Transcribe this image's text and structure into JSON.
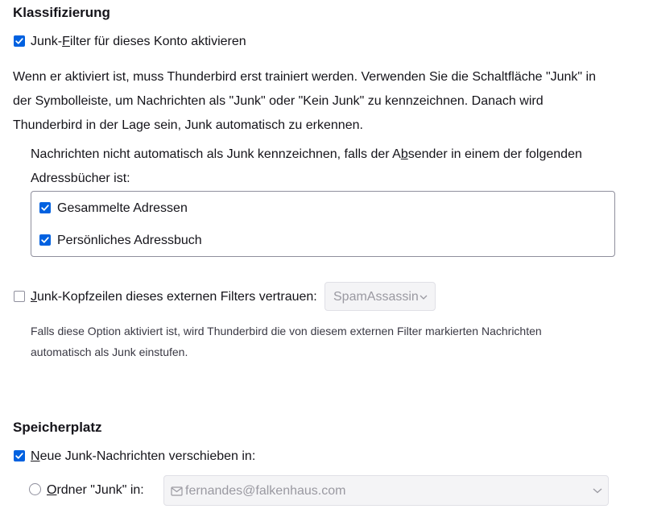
{
  "classification": {
    "heading": "Klassifizierung",
    "enable_junk": {
      "checked": true,
      "label_pre": "Junk-",
      "label_key": "F",
      "label_post": "ilter für dieses Konto aktivieren"
    },
    "description_lines": [
      "Wenn er aktiviert ist, muss Thunderbird erst trainiert werden. Verwenden Sie die Schaltfläche \"Junk\" in",
      "der Symbolleiste, um Nachrichten als \"Junk\" oder \"Kein Junk\" zu kennzeichnen. Danach wird",
      "Thunderbird in der Lage sein, Junk automatisch zu erkennen."
    ],
    "whitelist_intro": {
      "line1_pre": "Nachrichten nicht automatisch als Junk kennzeichnen, falls der A",
      "line1_key": "b",
      "line1_post": "sender in einem der folgenden",
      "line2": "Adressbücher ist:"
    },
    "address_books": [
      {
        "label": "Gesammelte Adressen",
        "checked": true
      },
      {
        "label": "Persönliches Adressbuch",
        "checked": true
      }
    ],
    "trust_headers": {
      "checked": false,
      "label_key": "J",
      "label_post": "unk-Kopfzeilen dieses externen Filters vertrauen:",
      "dropdown_value": "SpamAssassin"
    },
    "trust_note_lines": [
      "Falls diese Option aktiviert ist, wird Thunderbird die von diesem externen Filter markierten Nachrichten",
      "automatisch als Junk einstufen."
    ]
  },
  "storage": {
    "heading": "Speicherplatz",
    "move_junk": {
      "checked": true,
      "label_key": "N",
      "label_post": "eue Junk-Nachrichten verschieben in:"
    },
    "junk_folder": {
      "label_key": "O",
      "label_post": "rdner \"Junk\" in:",
      "account_value": "fernandes@falkenhaus.com"
    }
  },
  "colors": {
    "accent": "#0061e0",
    "text": "#15141a",
    "disabled_text": "#9a99a1"
  }
}
